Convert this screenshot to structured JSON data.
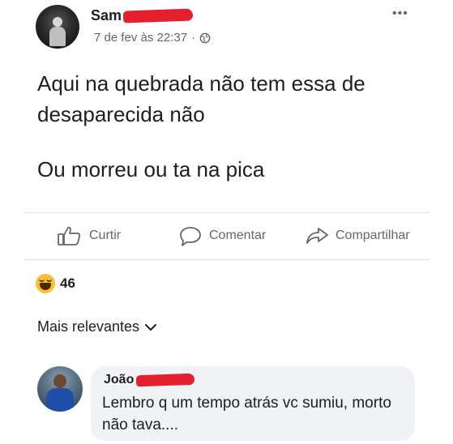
{
  "post": {
    "author_name": "Sam",
    "timestamp": "7 de fev às 22:37",
    "separator": "·",
    "privacy_icon": "globe-icon",
    "more_icon": "•••",
    "text_line_1": "Aqui na quebrada não tem essa de desaparecida não",
    "text_line_2": "Ou morreu ou ta na pica"
  },
  "actions": {
    "like": "Curtir",
    "comment": "Comentar",
    "share": "Compartilhar"
  },
  "reactions": {
    "icon": "haha-icon",
    "count": "46"
  },
  "comments": {
    "sort_label": "Mais relevantes",
    "items": [
      {
        "author_name": "João",
        "text": "Lembro q um tempo atrás vc sumiu, morto não tava...."
      }
    ]
  },
  "colors": {
    "redaction": "#e5202e",
    "secondary_text": "#606770",
    "bubble_bg": "#f0f2f5",
    "divider": "#dadde1"
  }
}
